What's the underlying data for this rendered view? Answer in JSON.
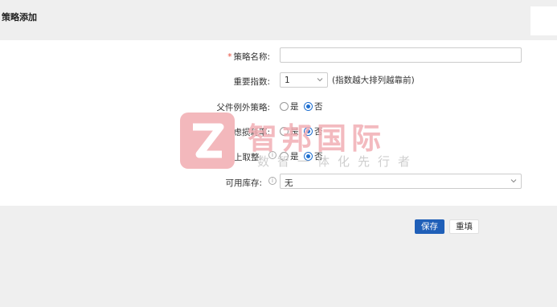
{
  "page": {
    "title": "策略添加"
  },
  "form": {
    "strategy_name": {
      "label": "策略名称:",
      "required_mark": "*",
      "value": "",
      "placeholder": ""
    },
    "importance": {
      "label": "重要指数:",
      "value": "1",
      "hint": "(指数越大排列越靠前)"
    },
    "parent_exception": {
      "label": "父件例外策略:",
      "options": [
        "是",
        "否"
      ],
      "selected": "否"
    },
    "consider_loss": {
      "label": "是否考虑损耗率:",
      "options": [
        "是",
        "否"
      ],
      "selected": "否"
    },
    "round_up": {
      "label": "是否向上取整:",
      "options": [
        "是",
        "否"
      ],
      "selected": "否"
    },
    "available_stock": {
      "label": "可用库存:",
      "value": "无"
    }
  },
  "actions": {
    "save_label": "保存",
    "reset_label": "重填"
  },
  "watermark": {
    "title": "智邦国际",
    "subtitle": "数智一体化先行者"
  },
  "colors": {
    "primary": "#1f5fb8",
    "radio_active": "#1f6fd0",
    "required": "#e74c3c"
  },
  "icons": {
    "info": "info-circle-icon",
    "dropdown": "chevron-down-icon"
  }
}
